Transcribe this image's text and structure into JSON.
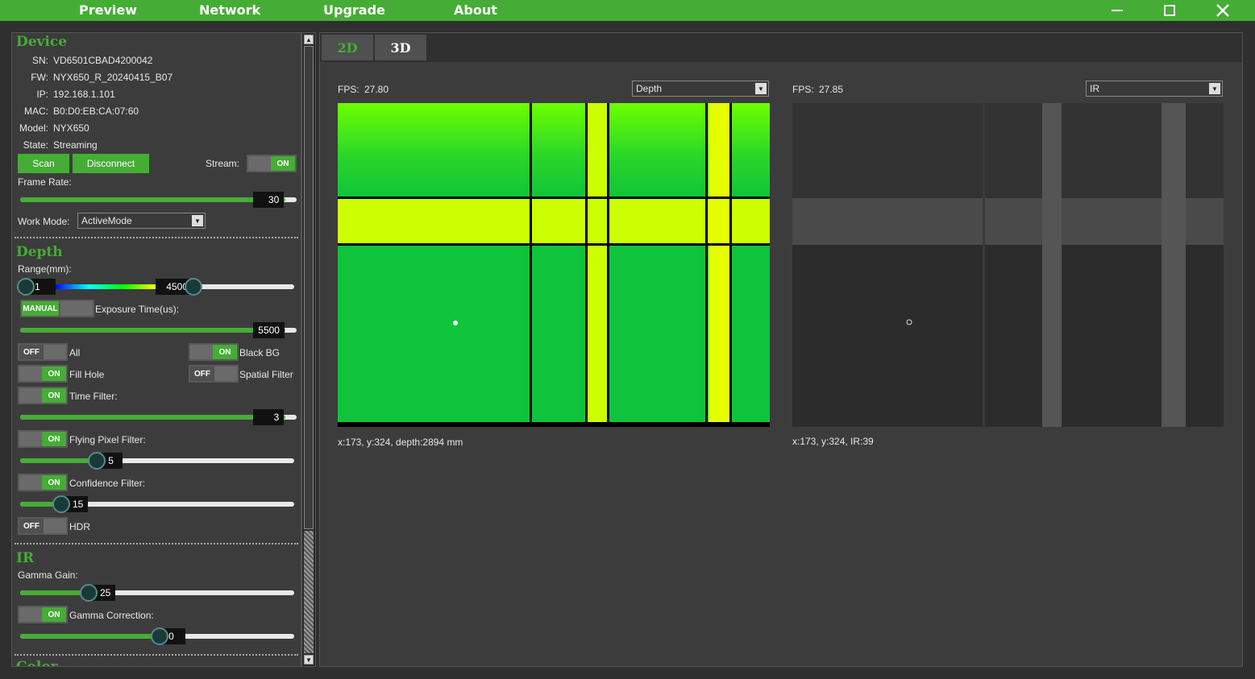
{
  "menu": {
    "preview": "Preview",
    "network": "Network",
    "upgrade": "Upgrade",
    "about": "About"
  },
  "window": {
    "minimize": "—",
    "maximize": "☐",
    "close": "✕"
  },
  "device": {
    "title": "Device",
    "sn_label": "SN:",
    "sn": "VD6501CBAD4200042",
    "fw_label": "FW:",
    "fw": "NYX650_R_20240415_B07",
    "ip_label": "IP:",
    "ip": "192.168.1.101",
    "mac_label": "MAC:",
    "mac": "B0:D0:EB:CA:07:60",
    "model_label": "Model:",
    "model": "NYX650",
    "state_label": "State:",
    "state": "Streaming",
    "scan": "Scan",
    "disconnect": "Disconnect",
    "stream_label": "Stream:",
    "stream_state": "ON",
    "frame_rate_label": "Frame Rate:",
    "frame_rate": "30",
    "frame_rate_fraction": 0.96,
    "work_mode_label": "Work Mode:",
    "work_mode": "ActiveMode"
  },
  "depth": {
    "title": "Depth",
    "range_label": "Range(mm):",
    "range_min": "1",
    "range_max": "4500",
    "exposure_mode": "MANUAL",
    "exposure_label": "Exposure Time(us):",
    "exposure": "5500",
    "exposure_fraction": 0.96,
    "all_state": "OFF",
    "all_label": "All",
    "black_bg_state": "ON",
    "black_bg_label": "Black BG",
    "fill_hole_state": "ON",
    "fill_hole_label": "Fill Hole",
    "spatial_state": "OFF",
    "spatial_label": "Spatial Filter",
    "time_state": "ON",
    "time_label": "Time Filter:",
    "time_value": "3",
    "time_fraction": 0.96,
    "flying_state": "ON",
    "flying_label": "Flying Pixel Filter:",
    "flying_value": "5",
    "flying_fraction": 0.28,
    "confidence_state": "ON",
    "confidence_label": "Confidence Filter:",
    "confidence_value": "15",
    "confidence_fraction": 0.15,
    "hdr_state": "OFF",
    "hdr_label": "HDR"
  },
  "ir": {
    "title": "IR",
    "gamma_gain_label": "Gamma Gain:",
    "gamma_gain": "25",
    "gamma_gain_fraction": 0.25,
    "gamma_corr_state": "ON",
    "gamma_corr_label": "Gamma Correction:",
    "gamma_corr": "50",
    "gamma_corr_fraction": 0.51
  },
  "color_partial": "Color",
  "tabs": {
    "t2d": "2D",
    "t3d": "3D"
  },
  "left_view": {
    "fps_label": "FPS:",
    "fps": "27.80",
    "mode": "Depth",
    "coord": "x:173, y:324, depth:2894 mm"
  },
  "right_view": {
    "fps_label": "FPS:",
    "fps": "27.85",
    "mode": "IR",
    "coord": "x:173, y:324, IR:39"
  },
  "colors": {
    "accent": "#45ad35",
    "bg": "#3c3c3c"
  }
}
